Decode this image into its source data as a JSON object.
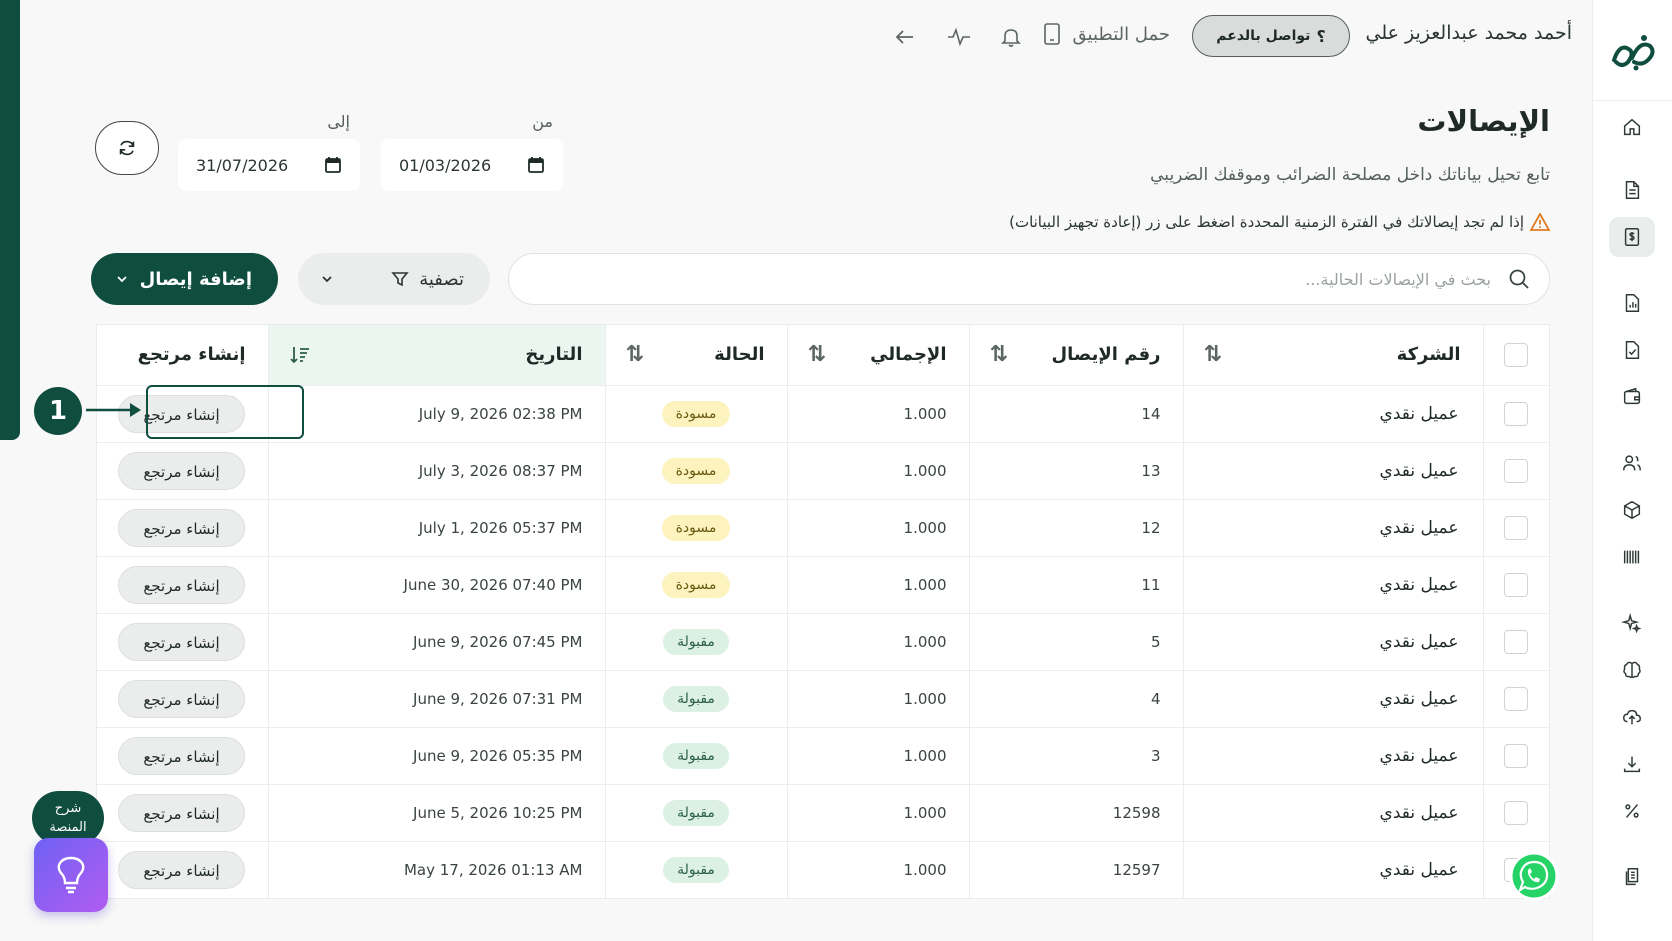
{
  "topbar": {
    "user_name": "أحمد محمد عبدالعزيز علي",
    "support_label": "تواصل بالدعم",
    "support_icon": "question-icon",
    "download_app_label": "حمل التطبيق"
  },
  "header": {
    "title": "الإيصالات",
    "subtitle": "تابع تحيل بياناتك داخل مصلحة الضرائب وموقفك الضريبي",
    "warning": "إذا لم تجد إيصالاتك في الفترة الزمنية المحددة اضغط على زر (إعادة تجهيز البيانات)"
  },
  "dates": {
    "from_label": "من",
    "from_value": "01/03/2026",
    "to_label": "إلى",
    "to_value": "31/07/2026"
  },
  "toolbar": {
    "search_placeholder": "بحث في الإيصالات الحالية...",
    "filter_label": "تصفية",
    "add_label": "إضافة إيصال"
  },
  "table": {
    "headers": {
      "company": "الشركة",
      "receipt_no": "رقم الإيصال",
      "total": "الإجمالي",
      "status": "الحالة",
      "date": "التاريخ",
      "action": "إنشاء مرتجع"
    },
    "action_label": "إنشاء مرتجع",
    "rows": [
      {
        "company": "عميل نقدي",
        "receipt_no": "14",
        "total": "1.000",
        "status": "مسودة",
        "status_type": "draft",
        "date": "July 9, 2026 02:38 PM"
      },
      {
        "company": "عميل نقدي",
        "receipt_no": "13",
        "total": "1.000",
        "status": "مسودة",
        "status_type": "draft",
        "date": "July 3, 2026 08:37 PM"
      },
      {
        "company": "عميل نقدي",
        "receipt_no": "12",
        "total": "1.000",
        "status": "مسودة",
        "status_type": "draft",
        "date": "July 1, 2026 05:37 PM"
      },
      {
        "company": "عميل نقدي",
        "receipt_no": "11",
        "total": "1.000",
        "status": "مسودة",
        "status_type": "draft",
        "date": "June 30, 2026 07:40 PM"
      },
      {
        "company": "عميل نقدي",
        "receipt_no": "5",
        "total": "1.000",
        "status": "مقبولة",
        "status_type": "accepted",
        "date": "June 9, 2026 07:45 PM"
      },
      {
        "company": "عميل نقدي",
        "receipt_no": "4",
        "total": "1.000",
        "status": "مقبولة",
        "status_type": "accepted",
        "date": "June 9, 2026 07:31 PM"
      },
      {
        "company": "عميل نقدي",
        "receipt_no": "3",
        "total": "1.000",
        "status": "مقبولة",
        "status_type": "accepted",
        "date": "June 9, 2026 05:35 PM"
      },
      {
        "company": "عميل نقدي",
        "receipt_no": "12598",
        "total": "1.000",
        "status": "مقبولة",
        "status_type": "accepted",
        "date": "June 5, 2026 10:25 PM"
      },
      {
        "company": "عميل نقدي",
        "receipt_no": "12597",
        "total": "1.000",
        "status": "مقبولة",
        "status_type": "accepted",
        "date": "May 17, 2026 01:13 AM"
      }
    ]
  },
  "annotation": {
    "step_number": "1"
  },
  "floating": {
    "explain_line1": "شرح",
    "explain_line2": "المنصة"
  },
  "colors": {
    "brand_green": "#0f4d3f",
    "draft_badge": "#fdf3bf",
    "accepted_badge": "#dcf1e4",
    "sorted_header": "#eaf6ef"
  }
}
